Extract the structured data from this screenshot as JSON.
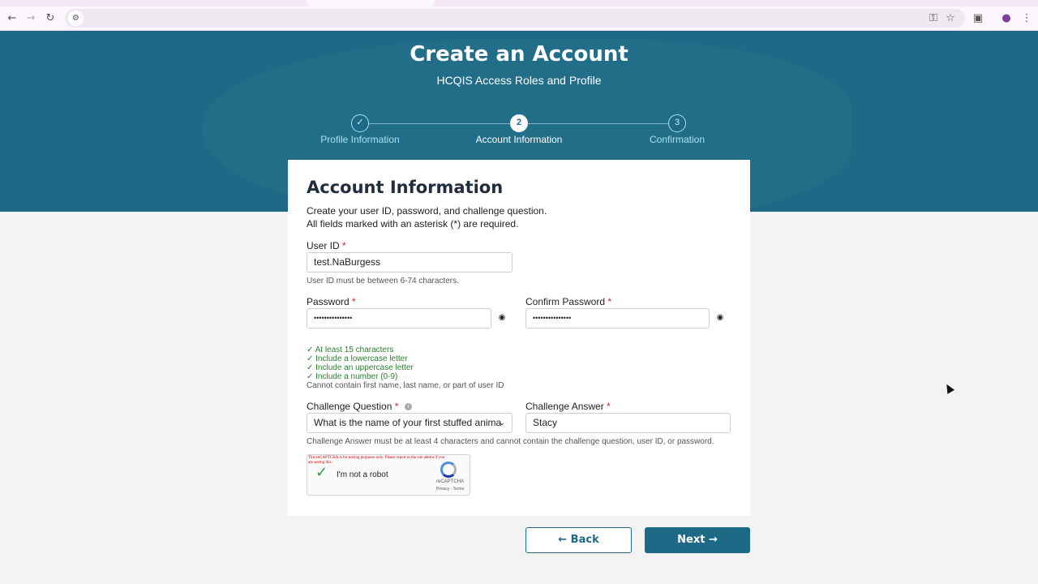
{
  "browser": {
    "icons": [
      "back-arrow-icon",
      "forward-arrow-icon",
      "reload-icon",
      "site-settings-icon",
      "password-key-icon",
      "bookmark-star-icon",
      "extensions-icon",
      "profile-icon",
      "menu-kebab-icon"
    ]
  },
  "header": {
    "title": "Create an Account",
    "subtitle": "HCQIS Access Roles and Profile"
  },
  "steps": [
    {
      "number": "✓",
      "label": "Profile Information",
      "state": "complete"
    },
    {
      "number": "2",
      "label": "Account Information",
      "state": "active"
    },
    {
      "number": "3",
      "label": "Confirmation",
      "state": "upcoming"
    }
  ],
  "form": {
    "heading": "Account Information",
    "intro_line1": "Create your user ID, password, and challenge question.",
    "intro_line2": "All fields marked with an asterisk (*) are required.",
    "user_id": {
      "label": "User ID",
      "required": "*",
      "value": "test.NaBurgess",
      "help": "User ID must be between 6-74 characters."
    },
    "password": {
      "label": "Password",
      "required": "*",
      "value": "•••••••••••••••"
    },
    "confirm_password": {
      "label": "Confirm Password",
      "required": "*",
      "value": "•••••••••••••••"
    },
    "password_rules": [
      "✓ At least 15 characters",
      "✓ Include a lowercase letter",
      "✓ Include an uppercase letter",
      "✓ Include a number (0-9)"
    ],
    "password_note": "Cannot contain first name, last name, or part of user ID",
    "challenge_question": {
      "label": "Challenge Question",
      "required": "*",
      "value": "What is the name of your first stuffed anima"
    },
    "challenge_answer": {
      "label": "Challenge Answer",
      "required": "*",
      "value": "Stacy"
    },
    "challenge_help": "Challenge Answer must be at least 4 characters and cannot contain the challenge question, user ID, or password."
  },
  "captcha": {
    "warning": "This reCAPTCHA is for testing purposes only. Please report to the site admin if you are seeing this.",
    "label": "I'm not a robot",
    "brand": "reCAPTCHA",
    "links": "Privacy - Terms"
  },
  "buttons": {
    "back": "← Back",
    "next": "Next →"
  },
  "colors": {
    "primary": "#1e6a86",
    "success": "#2e7d32",
    "required": "#c62828"
  }
}
